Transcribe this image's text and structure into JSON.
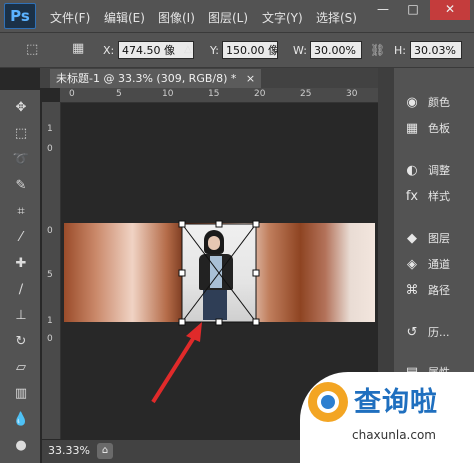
{
  "app": {
    "logo": "Ps"
  },
  "menu": [
    "文件(F)",
    "编辑(E)",
    "图像(I)",
    "图层(L)",
    "文字(Y)",
    "选择(S)"
  ],
  "window_controls": [
    "—",
    "□",
    "✕"
  ],
  "options_bar": {
    "x_label": "X:",
    "x_value": "474.50 像",
    "y_label": "Y:",
    "y_value": "150.00 像",
    "w_label": "W:",
    "w_value": "30.00%",
    "h_label": "H:",
    "h_value": "30.03%"
  },
  "document_tab": {
    "title": "未标题-1 @ 33.3% (309, RGB/8) *",
    "close": "×"
  },
  "ruler_h": [
    "0",
    "5",
    "10",
    "15",
    "20",
    "25",
    "30"
  ],
  "ruler_v": [
    "1",
    "0",
    "0",
    "5",
    "1",
    "0"
  ],
  "panels": [
    {
      "icon": "palette-icon",
      "glyph": "◉",
      "label": "颜色"
    },
    {
      "icon": "swatches-icon",
      "glyph": "▦",
      "label": "色板"
    },
    {
      "icon": "adjustments-icon",
      "glyph": "◐",
      "label": "调整"
    },
    {
      "icon": "styles-icon",
      "glyph": "fx",
      "label": "样式"
    },
    {
      "icon": "layers-icon",
      "glyph": "◆",
      "label": "图层"
    },
    {
      "icon": "channels-icon",
      "glyph": "◈",
      "label": "通道"
    },
    {
      "icon": "paths-icon",
      "glyph": "⌘",
      "label": "路径"
    },
    {
      "icon": "history-icon",
      "glyph": "↺",
      "label": "历..."
    },
    {
      "icon": "properties-icon",
      "glyph": "▤",
      "label": "属性"
    }
  ],
  "status": {
    "zoom": "33.33%"
  },
  "watermark": {
    "title": "查询啦",
    "url": "chaxunla.com"
  },
  "colors": {
    "arrow": "#e02a2a",
    "accent": "#2f71b8"
  }
}
